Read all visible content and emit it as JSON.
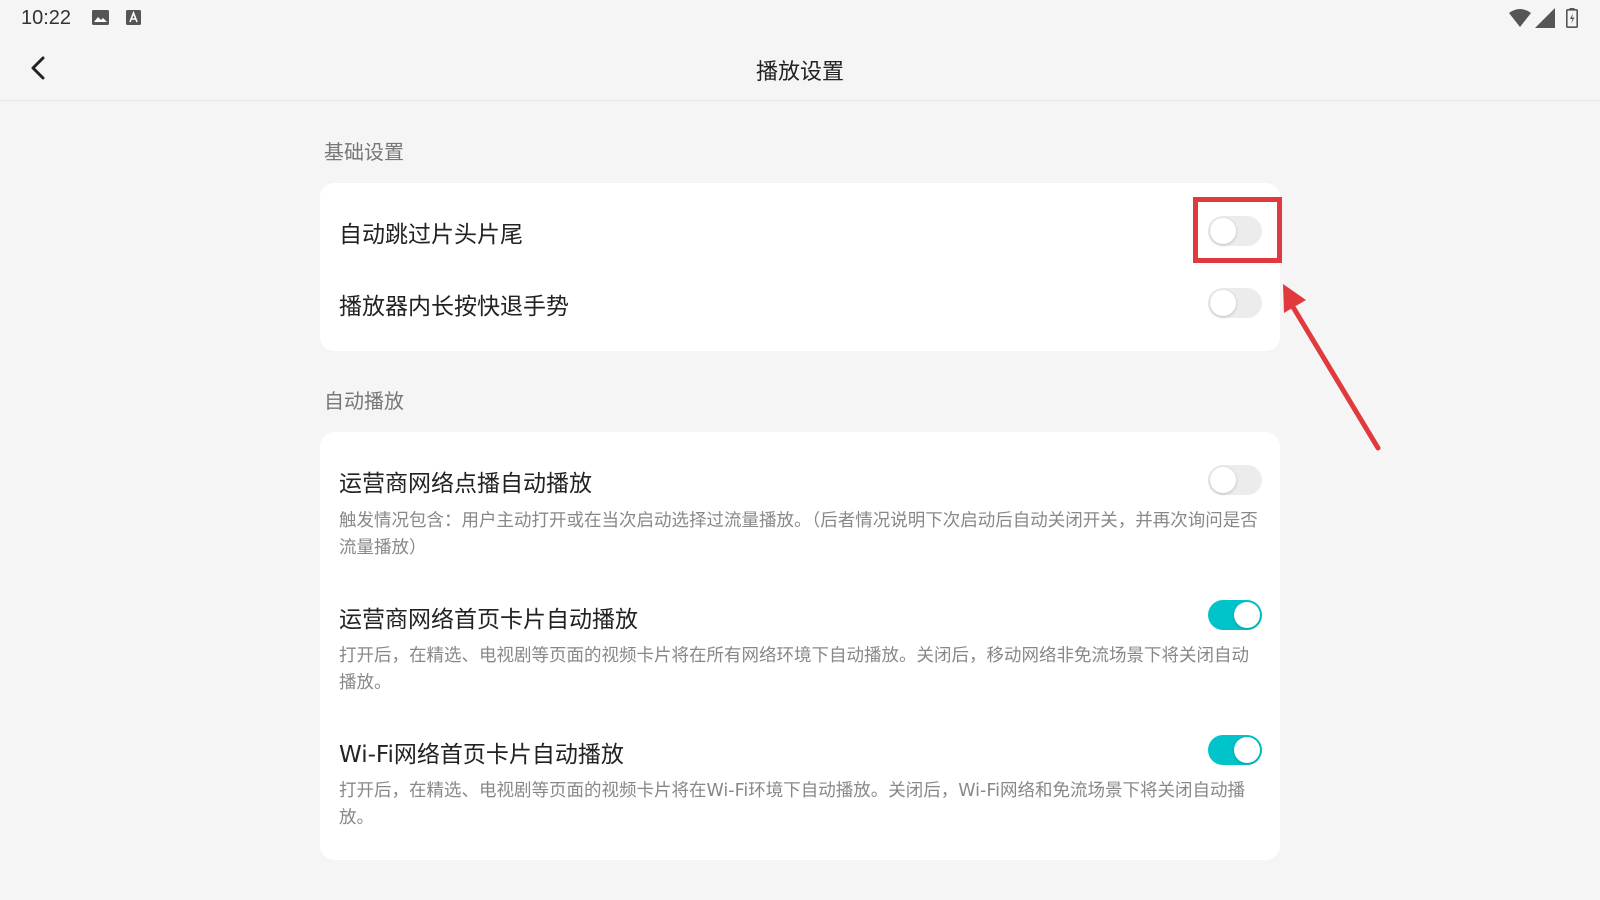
{
  "status_bar": {
    "time": "10:22",
    "left_icons": [
      "image-icon",
      "a-icon"
    ],
    "right_icons": [
      "wifi-icon",
      "signal-icon",
      "battery-icon"
    ]
  },
  "app_bar": {
    "back_icon": "chevron-left-icon",
    "title": "播放设置"
  },
  "sections": [
    {
      "label": "基础设置",
      "items": [
        {
          "title": "自动跳过片头片尾",
          "toggle": "off"
        },
        {
          "title": "播放器内长按快退手势",
          "toggle": "off"
        }
      ]
    },
    {
      "label": "自动播放",
      "items": [
        {
          "title": "运营商网络点播自动播放",
          "desc": "触发情况包含：用户主动打开或在当次启动选择过流量播放。（后者情况说明下次启动后自动关闭开关，并再次询问是否流量播放）",
          "toggle": "off"
        },
        {
          "title": "运营商网络首页卡片自动播放",
          "desc": "打开后，在精选、电视剧等页面的视频卡片将在所有网络环境下自动播放。关闭后，移动网络非免流场景下将关闭自动播放。",
          "toggle": "on"
        },
        {
          "title": "Wi-Fi网络首页卡片自动播放",
          "desc": "打开后，在精选、电视剧等页面的视频卡片将在Wi-Fi环境下自动播放。关闭后，Wi-Fi网络和免流场景下将关闭自动播放。",
          "toggle": "on"
        }
      ]
    }
  ],
  "colors": {
    "accent": "#00c4c9",
    "toggle_off": "#ececec",
    "annotation": "#e03a3e",
    "background": "#f5f5f5"
  }
}
